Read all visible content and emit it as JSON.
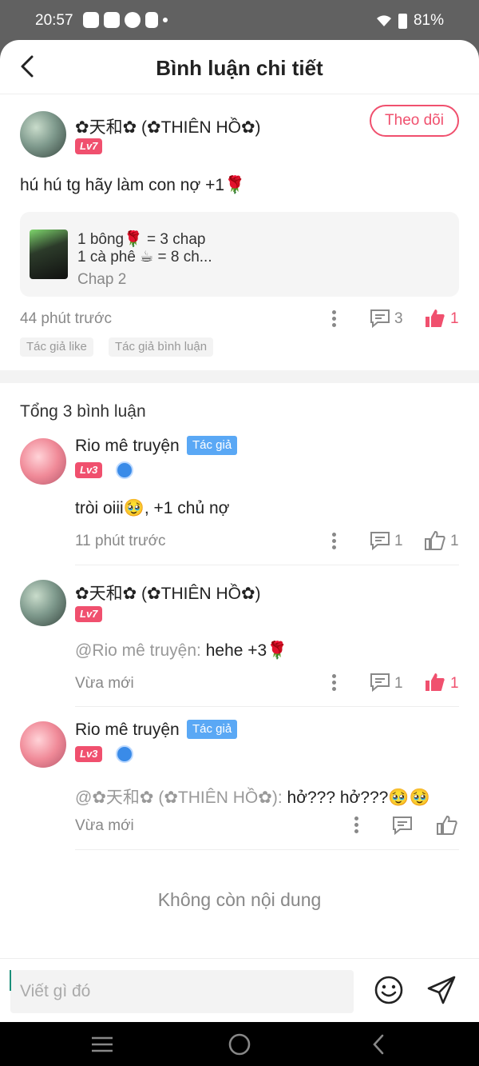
{
  "status_bar": {
    "time": "20:57",
    "battery": "81%"
  },
  "header": {
    "title": "Bình luận chi tiết"
  },
  "post": {
    "username": "✿天和✿ (✿THIÊN HỒ✿)",
    "level": "Lv7",
    "follow_label": "Theo dõi",
    "text": "hú hú tg hãy làm con nợ +1🌹",
    "card": {
      "line1": "1 bông🌹 = 3 chap",
      "line2": "1 cà phê ☕ = 8 ch...",
      "chapter": "Chap 2"
    },
    "time": "44 phút trước",
    "comment_count": "3",
    "like_count": "1",
    "tags": [
      "Tác giả like",
      "Tác giả bình luận"
    ]
  },
  "comments_header": {
    "total": "Tổng 3 bình luận"
  },
  "comments": [
    {
      "username": "Rio mê truyện",
      "author_tag": "Tác giả",
      "level": "Lv3",
      "mention": "",
      "text": "tròi oiii🥹, +1 chủ nợ",
      "time": "11 phút trước",
      "reply_count": "1",
      "like_count": "1"
    },
    {
      "username": "✿天和✿ (✿THIÊN HỒ✿)",
      "level": "Lv7",
      "mention": "@Rio mê truyện:",
      "text": "hehe +3🌹",
      "time": "Vừa mới",
      "reply_count": "1",
      "like_count": "1"
    },
    {
      "username": "Rio mê truyện",
      "author_tag": "Tác giả",
      "level": "Lv3",
      "mention": "@✿天和✿ (✿THIÊN HỒ✿):",
      "text": "hở??? hở???🥹🥹",
      "time": "Vừa mới"
    }
  ],
  "end_message": "Không còn nội dung",
  "input": {
    "placeholder": "Viết gì đó"
  },
  "colors": {
    "accent": "#f0506e",
    "author_tag": "#5aa8f5",
    "muted": "#888888"
  }
}
